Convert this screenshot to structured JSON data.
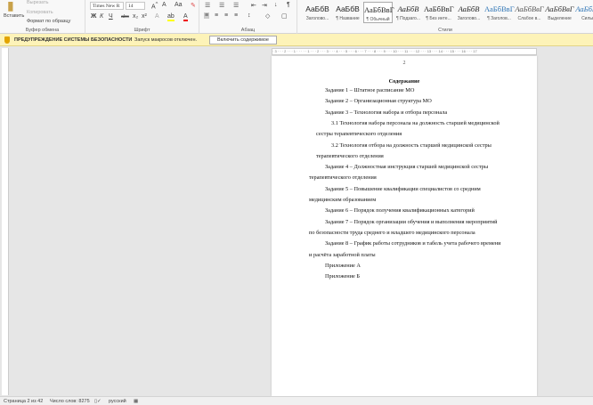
{
  "ribbon": {
    "clipboard": {
      "paste": "Вставить",
      "cut": "Вырезать",
      "copy": "Копировать",
      "format_painter": "Формат по образцу",
      "label": "Буфер обмена"
    },
    "font": {
      "name": "Times New R",
      "size": "14",
      "label": "Шрифт",
      "bold": "Ж",
      "italic": "К",
      "underline": "Ч",
      "strike": "abc",
      "sub": "x₂",
      "sup": "x²"
    },
    "paragraph": {
      "label": "Абзац"
    },
    "styles": {
      "label": "Стили",
      "items": [
        {
          "preview": "АаБбВ",
          "name": "Заголово..."
        },
        {
          "preview": "АаБбВ",
          "name": "¶ Название"
        },
        {
          "preview": "АаБбВвГ",
          "name": "¶ Обычный"
        },
        {
          "preview": "АаБбВ",
          "name": "¶ Подзаго..."
        },
        {
          "preview": "АаБбВвГ",
          "name": "¶ Без инте..."
        },
        {
          "preview": "АаБбВ",
          "name": "Заголово..."
        },
        {
          "preview": "АаБбВвГ",
          "name": "¶ Заголов..."
        },
        {
          "preview": "АаБбВвГ",
          "name": "Слабое в..."
        },
        {
          "preview": "АаБбВвГ",
          "name": "Выделение"
        },
        {
          "preview": "АаБбВвГ",
          "name": "Сильн..."
        }
      ]
    }
  },
  "warning": {
    "title": "ПРЕДУПРЕЖДЕНИЕ СИСТЕМЫ БЕЗОПАСНОСТИ",
    "message": "Запуск макросов отключен.",
    "button": "Включить содержимое",
    "color": "#fdf3b8"
  },
  "document": {
    "page_number": "2",
    "title": "Содержание",
    "lines": [
      "Задание 1 – Штатное расписание МО",
      "Задание 2 – Организационная структура МО",
      "Задание 3 – Технология набора и отбора персонала",
      "3.1 Технология набора персонала на должность старшей медицинской",
      "сестры терапевтического отделения",
      "3.2 Технология отбора на должность старшей медицинской сестры",
      "терапевтического отделения",
      "Задание 4 – Должностная инструкция старшей медицинской сестры",
      "терапевтического отделения",
      "Задание 5 – Повышение квалификации специалистов со средним",
      "медицинским образованием",
      "Задание 6 – Порядок получения квалификационных категорий",
      "Задание 7 – Порядок организации обучения и выполнения мероприятий",
      "по безопасности труда среднего и младшего медицинского персонала",
      "Задание 8 – График работы сотрудников и табель учета рабочего времени",
      "и расчёта заработной платы",
      "Приложение А",
      "Приложение Б"
    ]
  },
  "ruler": "· 3 · · · 2 · · · 1 · · · · · 1 · · · 2 · · · 3 · · · 4 · · · 5 · · · 6 · · · 7 · · · 8 · · · 9 · · · 10 · · · 11 · · · 12 · · · 13 · · · 14 · · · 15 · · · 16 · · · 17",
  "status": {
    "page": "Страница 2 из 42",
    "words": "Число слов: 8275",
    "language": "русский"
  }
}
